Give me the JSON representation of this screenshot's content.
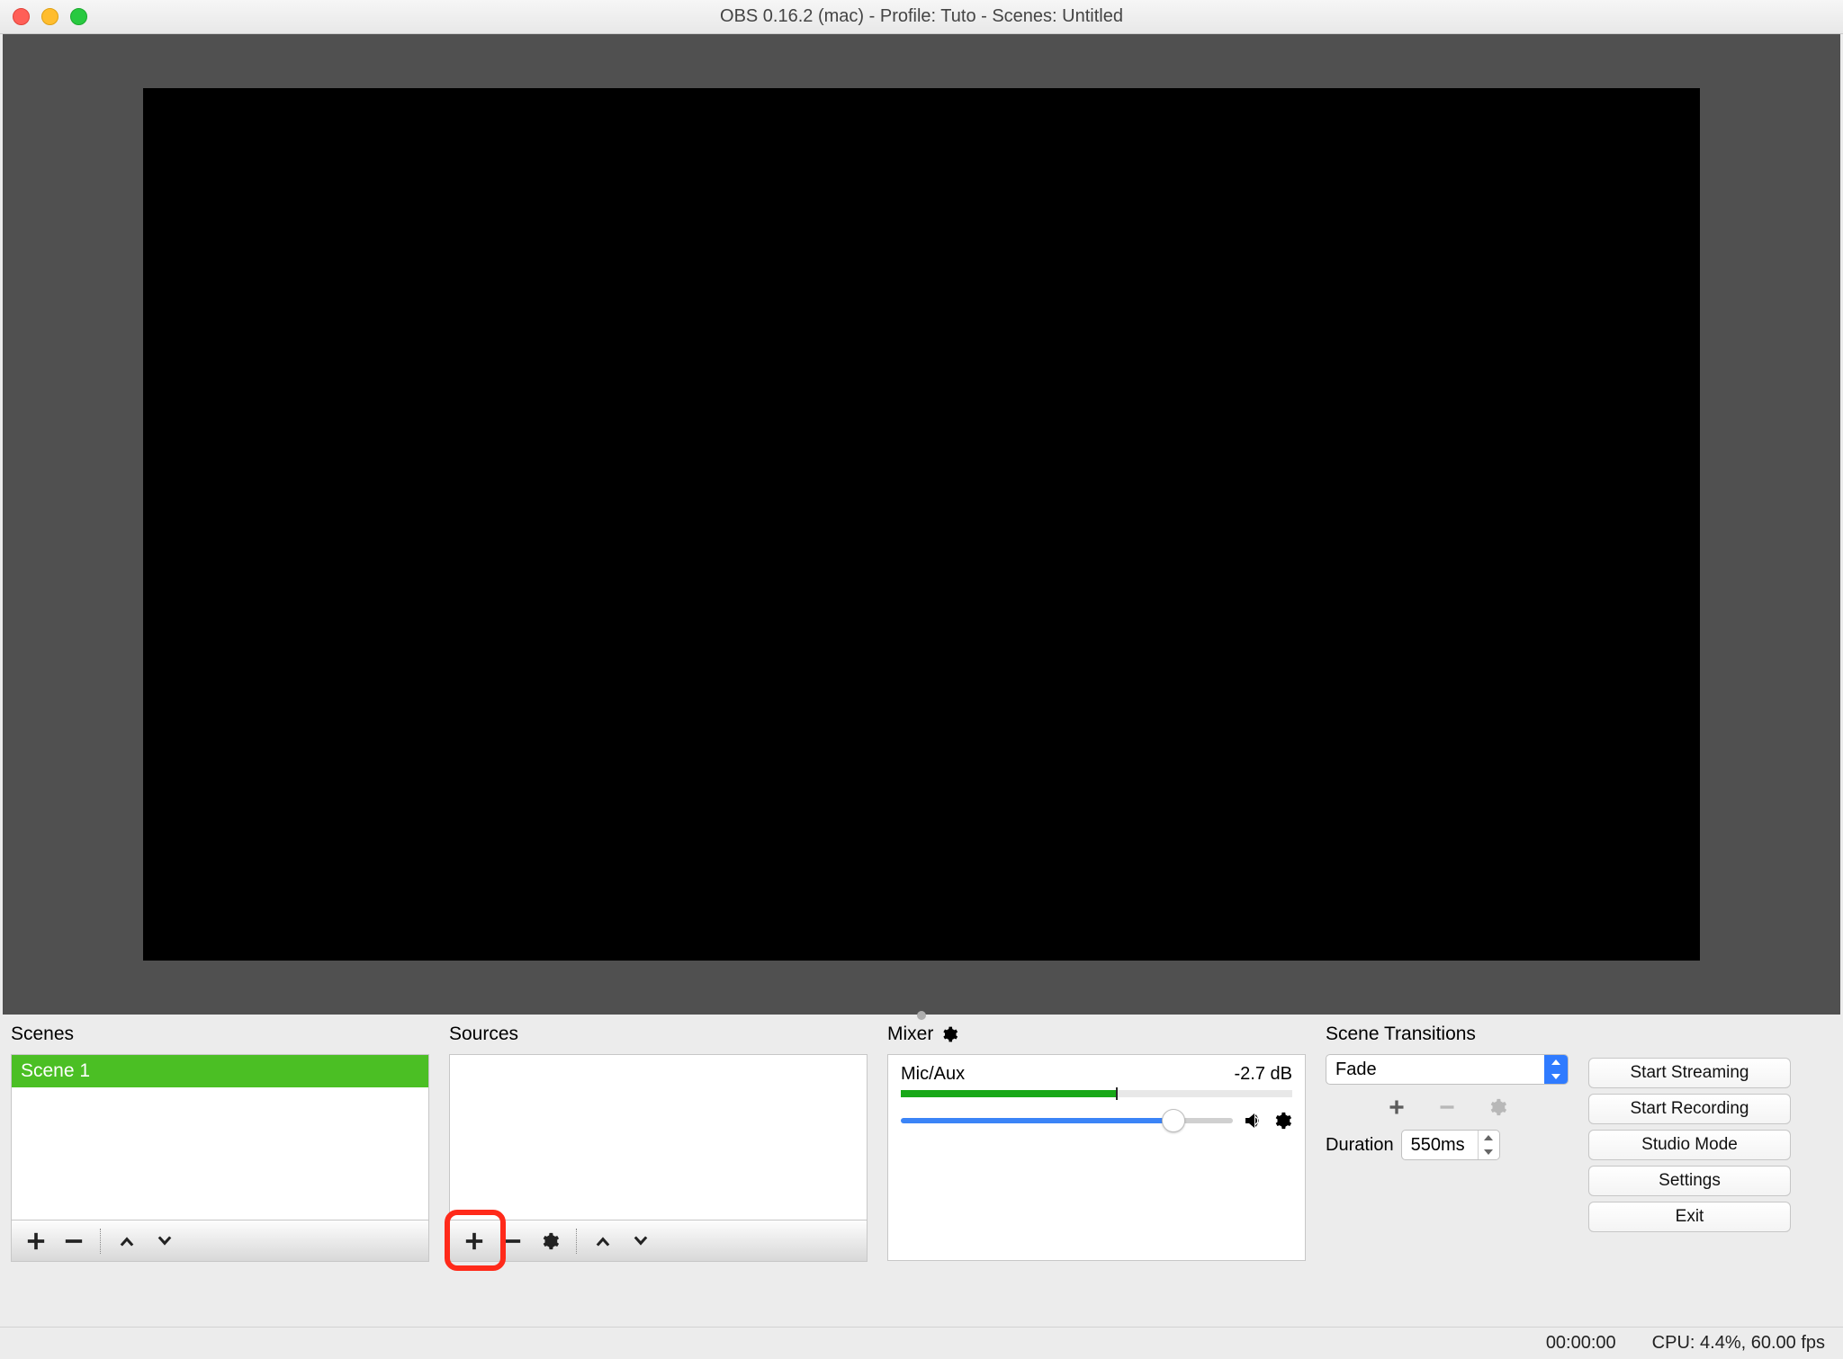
{
  "window": {
    "title": "OBS 0.16.2 (mac) - Profile: Tuto - Scenes: Untitled"
  },
  "panels": {
    "scenes_label": "Scenes",
    "sources_label": "Sources",
    "mixer_label": "Mixer",
    "transitions_label": "Scene Transitions"
  },
  "scenes": {
    "items": [
      "Scene 1"
    ]
  },
  "mixer": {
    "channel_name": "Mic/Aux",
    "channel_level": "-2.7 dB"
  },
  "transitions": {
    "selected": "Fade",
    "duration_label": "Duration",
    "duration_value": "550ms"
  },
  "actions": {
    "start_streaming": "Start Streaming",
    "start_recording": "Start Recording",
    "studio_mode": "Studio Mode",
    "settings": "Settings",
    "exit": "Exit"
  },
  "status": {
    "time": "00:00:00",
    "cpu": "CPU: 4.4%, 60.00 fps"
  }
}
